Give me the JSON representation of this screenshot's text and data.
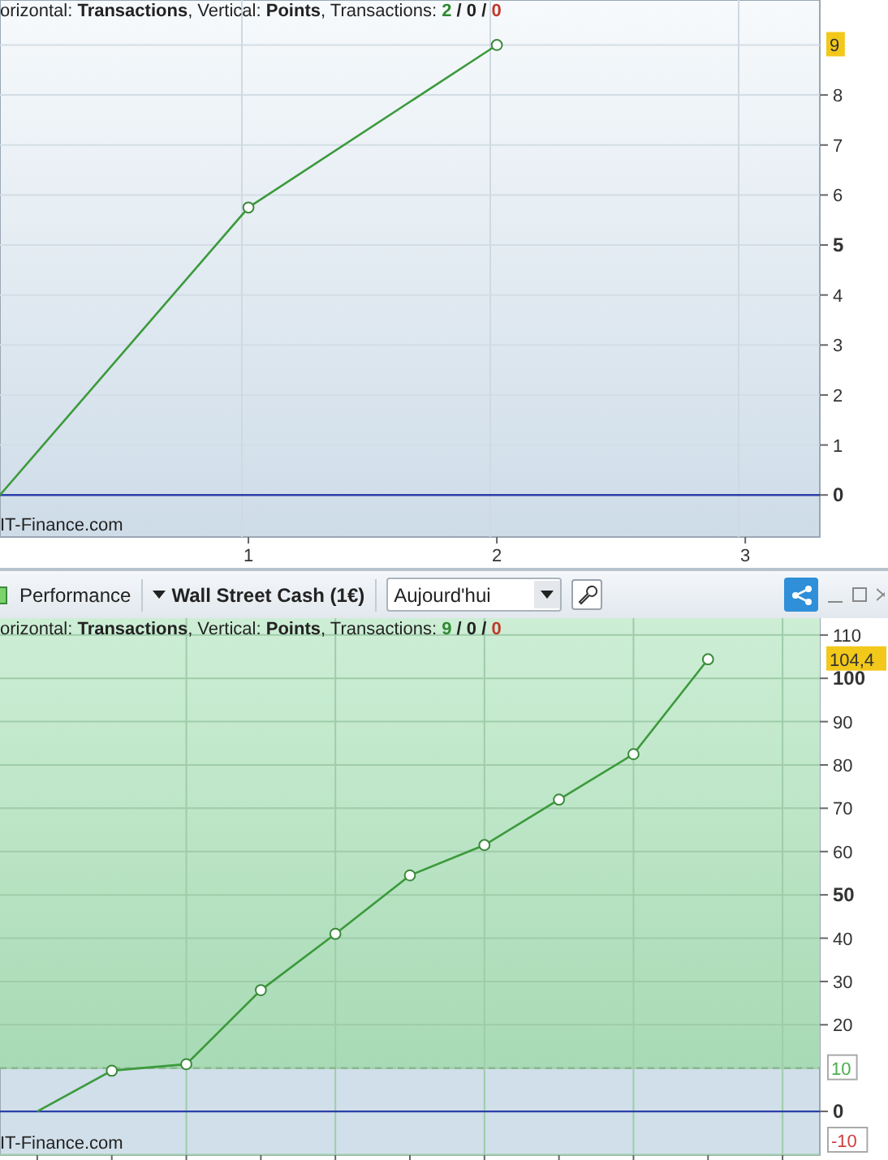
{
  "top_chart": {
    "caption": {
      "before": "orizontal: **Transactions**, Vertical: ",
      "after": ", Transactions: ",
      "counts": [
        {
          "text": "2",
          "color": "#2f8a2f"
        },
        {
          "text": "/",
          "color": "#222222"
        },
        {
          "text": "0",
          "color": "#222222"
        },
        {
          "text": "/",
          "color": "#222222"
        },
        {
          "text": "0",
          "color": "#c0392b"
        }
      ]
    },
    "copyright": "IT-Finance.com",
    "last_value": "9",
    "chart_data": {
      "type": "line",
      "x": [
        0,
        1,
        2
      ],
      "series": [
        {
          "name": "Points",
          "color": "#3c9a3c",
          "marker": "circle",
          "values": [
            0,
            5.75,
            9
          ]
        }
      ],
      "xlim": [
        0,
        3.3
      ],
      "ylim": [
        -0.84,
        9.9
      ],
      "xticks": [
        1,
        2,
        3
      ],
      "yticks": [
        0,
        1,
        2,
        3,
        4,
        5,
        6,
        7,
        8
      ],
      "grid": true,
      "ref_lines": [
        {
          "axis": "y",
          "value": 0,
          "color": "#2b3fa8"
        }
      ]
    }
  },
  "toolbar": {
    "chart_type": "Performance",
    "instrument": "Wall Street Cash (1€)",
    "period_select": {
      "value": "Aujourd'hui"
    }
  },
  "bottom_chart": {
    "caption": {
      "before": "orizontal: **Transactions**, Vertical: ",
      "after": ", Transactions: ",
      "counts": [
        {
          "text": "9",
          "color": "#2f8a2f"
        },
        {
          "text": "/",
          "color": "#222222"
        },
        {
          "text": "0",
          "color": "#222222"
        },
        {
          "text": "/",
          "color": "#222222"
        },
        {
          "text": "0",
          "color": "#c0392b"
        }
      ]
    },
    "copyright": "IT-Finance.com",
    "last_value": "104,4",
    "chart_data": {
      "type": "line",
      "categories": [
        null,
        null,
        null,
        null,
        null,
        null,
        null,
        null,
        null,
        null,
        null
      ],
      "series": [
        {
          "name": "Points",
          "color": "#3c9a3c",
          "marker": "circle",
          "values": [
            0,
            9.4,
            10.9,
            28,
            41,
            54.5,
            61.5,
            72,
            82.5,
            104.4,
            null
          ]
        }
      ],
      "ylim": [
        -10.1,
        113.9
      ],
      "yticks": [
        -10,
        0,
        10,
        20,
        30,
        40,
        50,
        60,
        70,
        80,
        90,
        100,
        110
      ],
      "grid": true,
      "ref_lines": [
        {
          "axis": "y",
          "value": 0,
          "color": "#2b3fa8"
        },
        {
          "axis": "y",
          "value": 10,
          "color": "#88b890"
        }
      ]
    }
  }
}
